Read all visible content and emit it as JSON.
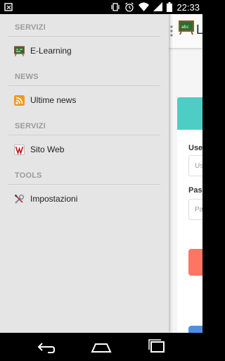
{
  "status_bar": {
    "time": "22:33",
    "icons": [
      "notification-icon",
      "vibrate-icon",
      "alarm-icon",
      "wifi-icon",
      "signal-icon",
      "battery-icon"
    ]
  },
  "app": {
    "title": "Le",
    "login_form": {
      "username_label": "Use",
      "username_placeholder": "Us",
      "password_label": "Pass",
      "password_placeholder": "Pa"
    },
    "colors": {
      "header_card": "#4ecdc4",
      "login_button": "#ff7463",
      "secondary_button": "#4f8fe0"
    }
  },
  "drawer": {
    "sections": [
      {
        "header": "SERVIZI",
        "items": [
          {
            "label": "E-Learning",
            "icon": "chalkboard-icon"
          }
        ]
      },
      {
        "header": "NEWS",
        "items": [
          {
            "label": "Ultime news",
            "icon": "rss-icon"
          }
        ]
      },
      {
        "header": "SERVIZI",
        "items": [
          {
            "label": "Sito Web",
            "icon": "website-icon"
          }
        ]
      },
      {
        "header": "TOOLS",
        "items": [
          {
            "label": "Impostazioni",
            "icon": "tools-icon"
          }
        ]
      }
    ]
  },
  "nav_bar": {
    "buttons": [
      "back-icon",
      "home-icon",
      "recents-icon"
    ]
  }
}
